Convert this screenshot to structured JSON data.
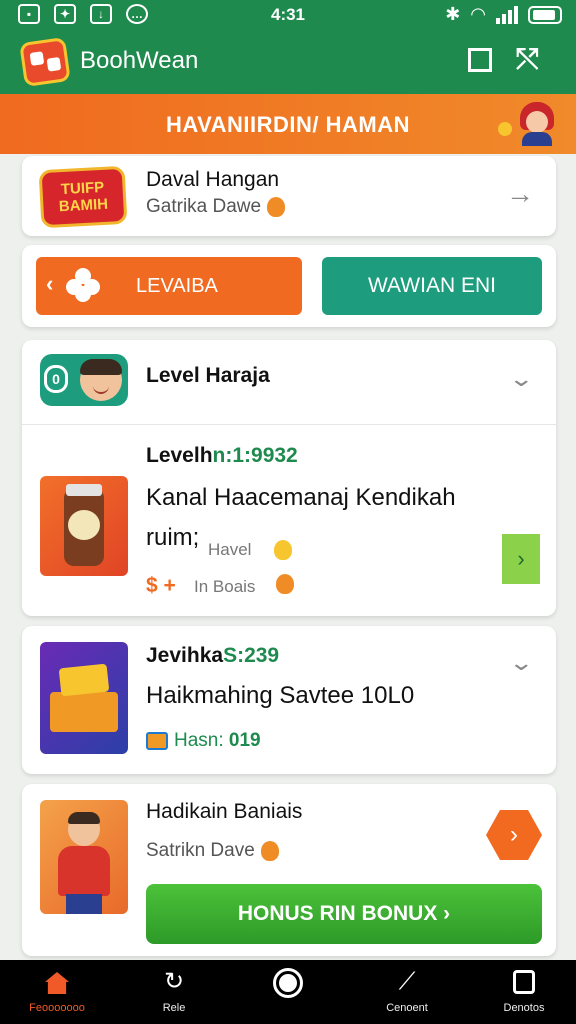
{
  "status_bar": {
    "time": "4:31",
    "left_icons": [
      "notification-icon",
      "image-icon",
      "download-icon",
      "message-icon"
    ],
    "right_icons": [
      "bluetooth-icon",
      "wifi-icon",
      "signal-icon",
      "battery-icon"
    ]
  },
  "app_bar": {
    "title": "BoohWean"
  },
  "banner": {
    "title": "HAVANIIRDIN/ HAMAN"
  },
  "card_profile": {
    "emblem_text": "TUIFP BAMIH",
    "title": "Daval Hangan",
    "subtitle": "Gatrika Dawe"
  },
  "action_buttons": {
    "left_label": "LEVAIBA",
    "right_label": "WAWIAN ENI"
  },
  "card_level": {
    "header_title": "Level Haraja",
    "item_code_prefix": "Levelh",
    "item_code_value": "n:1:9932",
    "item_title": "Kanal Haacemanaj Kendikah",
    "item_sub_prefix": "ruim;",
    "item_sub_small": "Havel",
    "item_price": "$ +",
    "item_price_note": "In Boais"
  },
  "card_chest": {
    "code_prefix": "Jevihka",
    "code_value": "S:239",
    "title": "Haikmahing Savtee 10L0",
    "sub_label": "Hasn:",
    "sub_value": "019"
  },
  "card_bonus": {
    "title": "Hadikain Baniais",
    "subtitle": "Satrikn Dave",
    "button_label": "HONUS RIN BONUX ›"
  },
  "bottom_nav": [
    {
      "label": "Feooooooo",
      "icon": "home-icon",
      "active": true
    },
    {
      "label": "Rele",
      "icon": "refresh-icon",
      "active": false
    },
    {
      "label": "",
      "icon": "record-icon",
      "active": false
    },
    {
      "label": "Cenoent",
      "icon": "chart-icon",
      "active": false
    },
    {
      "label": "Denotos",
      "icon": "bag-icon",
      "active": false
    }
  ],
  "colors": {
    "primary_green": "#1e8a4e",
    "orange": "#f06a22",
    "teal": "#1d9c7e",
    "bonus_green": "#3cb531"
  }
}
